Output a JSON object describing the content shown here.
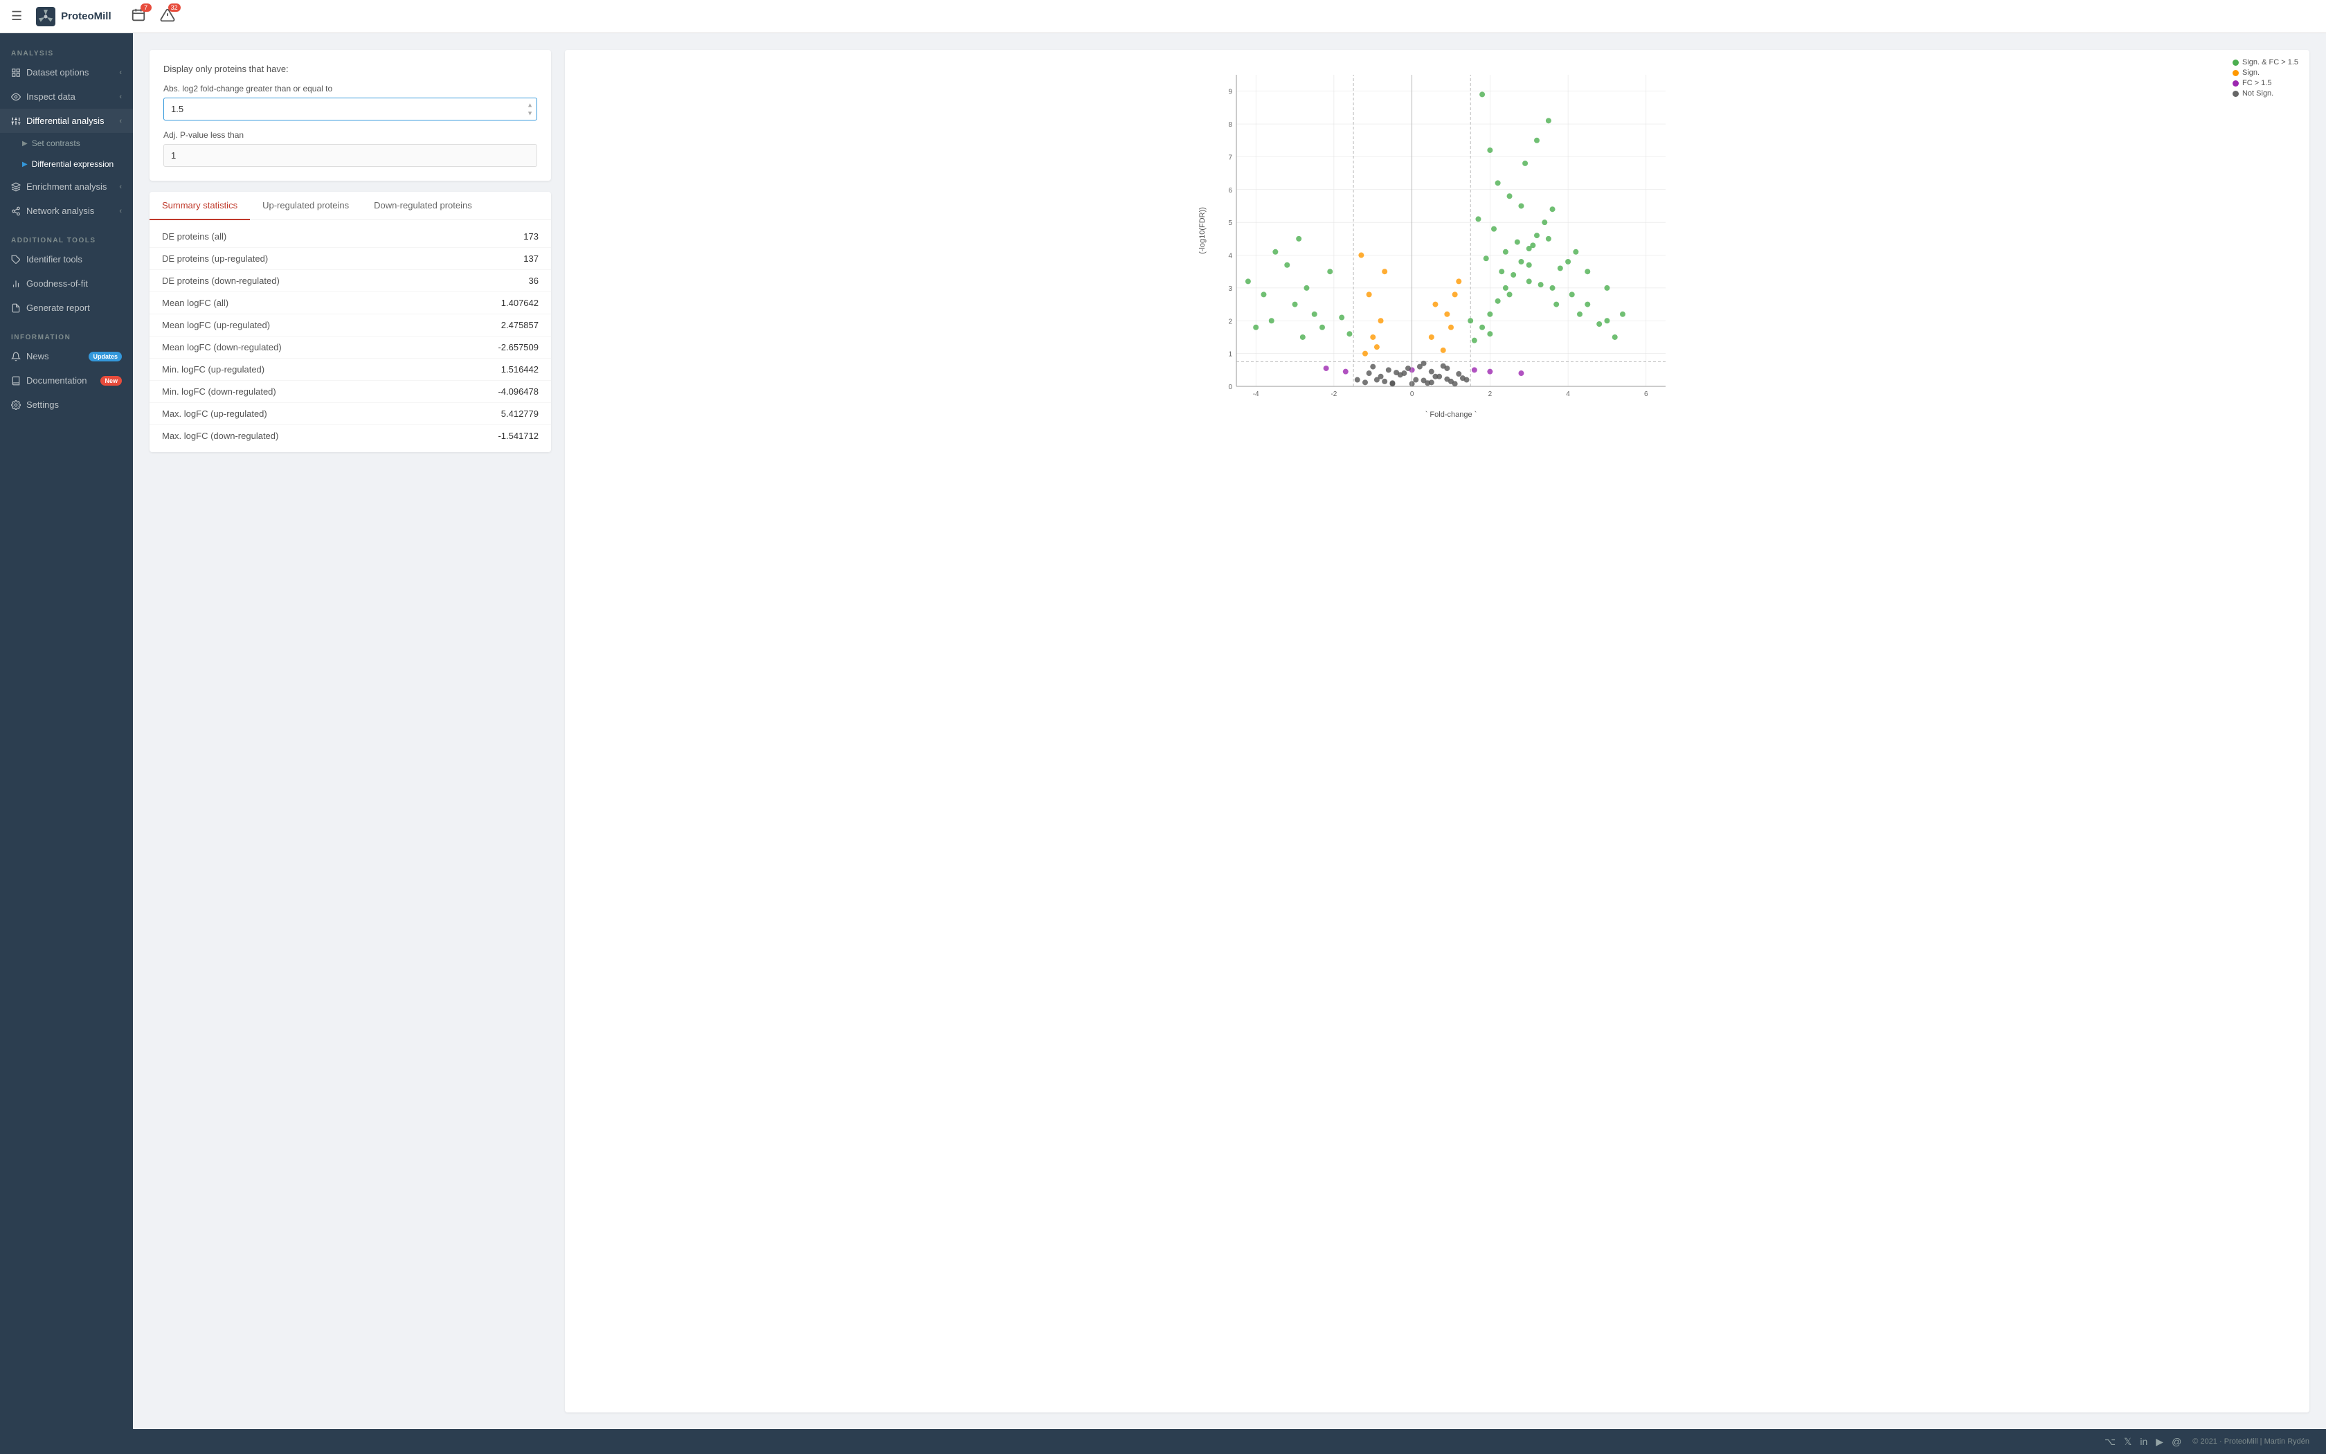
{
  "app": {
    "name": "ProteoMill",
    "logo_alt": "windmill"
  },
  "topbar": {
    "hamburger_label": "☰",
    "badge1_count": "7",
    "badge2_count": "32"
  },
  "sidebar": {
    "sections": [
      {
        "label": "ANALYSIS",
        "items": [
          {
            "id": "dataset-options",
            "label": "Dataset options",
            "icon": "grid",
            "has_chevron": true
          },
          {
            "id": "inspect-data",
            "label": "Inspect data",
            "icon": "eye",
            "has_chevron": true
          },
          {
            "id": "differential-analysis",
            "label": "Differential analysis",
            "icon": "sliders",
            "has_chevron": true,
            "expanded": true,
            "subitems": [
              {
                "id": "set-contrasts",
                "label": "Set contrasts",
                "active": false
              },
              {
                "id": "differential-expression",
                "label": "Differential expression",
                "active": true
              }
            ]
          },
          {
            "id": "enrichment-analysis",
            "label": "Enrichment analysis",
            "icon": "layers",
            "has_chevron": true
          },
          {
            "id": "network-analysis",
            "label": "Network analysis",
            "icon": "share2",
            "has_chevron": true
          }
        ]
      },
      {
        "label": "ADDITIONAL TOOLS",
        "items": [
          {
            "id": "identifier-tools",
            "label": "Identifier tools",
            "icon": "tag"
          },
          {
            "id": "goodness-of-fit",
            "label": "Goodness-of-fit",
            "icon": "bar-chart"
          },
          {
            "id": "generate-report",
            "label": "Generate report",
            "icon": "file"
          }
        ]
      },
      {
        "label": "INFORMATION",
        "items": [
          {
            "id": "news",
            "label": "News",
            "icon": "bell",
            "badge": "Updates",
            "badge_class": "badge-updates"
          },
          {
            "id": "documentation",
            "label": "Documentation",
            "icon": "book",
            "badge": "New",
            "badge_class": "badge-new"
          },
          {
            "id": "settings",
            "label": "Settings",
            "icon": "settings"
          }
        ]
      }
    ]
  },
  "main": {
    "filter_section": {
      "display_text": "Display only proteins that have:",
      "fc_label": "Abs. log2 fold-change greater than or equal to",
      "fc_value": "1.5",
      "pval_label": "Adj. P-value less than",
      "pval_value": "1"
    },
    "tabs": [
      {
        "id": "summary-statistics",
        "label": "Summary statistics",
        "active": true
      },
      {
        "id": "up-regulated-proteins",
        "label": "Up-regulated proteins",
        "active": false
      },
      {
        "id": "down-regulated-proteins",
        "label": "Down-regulated proteins",
        "active": false
      }
    ],
    "stats": [
      {
        "label": "DE proteins (all)",
        "value": "173"
      },
      {
        "label": "DE proteins (up-regulated)",
        "value": "137"
      },
      {
        "label": "DE proteins (down-regulated)",
        "value": "36"
      },
      {
        "label": "Mean logFC (all)",
        "value": "1.407642"
      },
      {
        "label": "Mean logFC (up-regulated)",
        "value": "2.475857"
      },
      {
        "label": "Mean logFC (down-regulated)",
        "value": "-2.657509"
      },
      {
        "label": "Min. logFC (up-regulated)",
        "value": "1.516442"
      },
      {
        "label": "Min. logFC (down-regulated)",
        "value": "-4.096478"
      },
      {
        "label": "Max. logFC (up-regulated)",
        "value": "5.412779"
      },
      {
        "label": "Max. logFC (down-regulated)",
        "value": "-1.541712"
      }
    ],
    "volcano": {
      "x_label": "` Fold-change `",
      "y_label": "(-log10(FDR))",
      "legend": [
        {
          "label": "Sign. & FC > 1.5",
          "color": "#4caf50"
        },
        {
          "label": "Sign.",
          "color": "#ff9800"
        },
        {
          "label": "FC > 1.5",
          "color": "#9c27b0"
        },
        {
          "label": "Not Sign.",
          "color": "#666"
        }
      ]
    }
  },
  "footer": {
    "copyright": "© 2021 · ProteoMill | Martin Rydén",
    "icons": [
      "github",
      "twitter",
      "linkedin",
      "youtube",
      "at"
    ]
  }
}
